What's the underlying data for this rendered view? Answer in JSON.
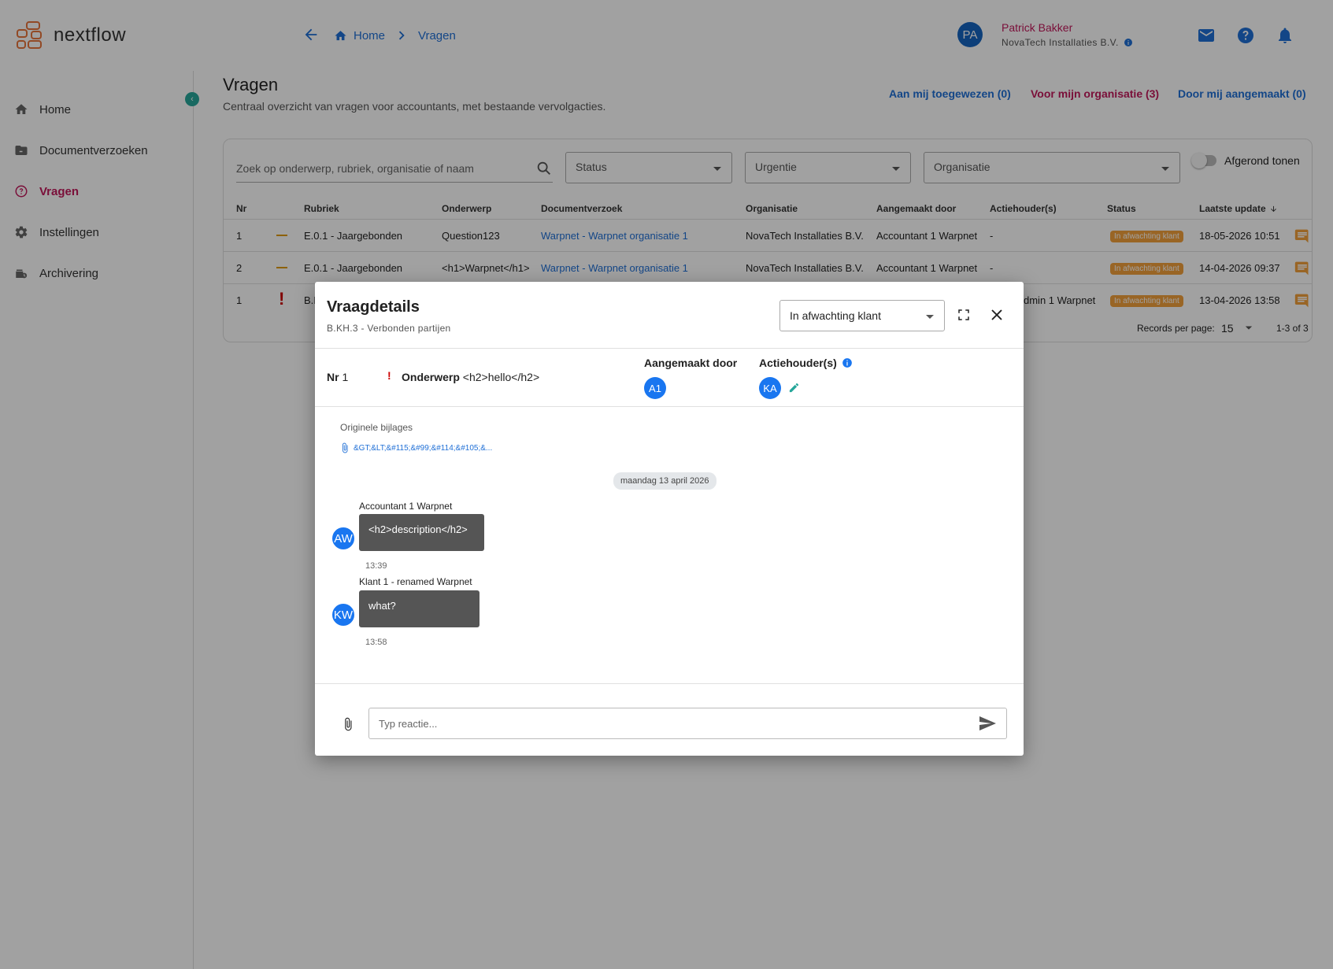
{
  "app": {
    "name": "nextflow"
  },
  "breadcrumb": {
    "home": "Home",
    "current": "Vragen"
  },
  "user": {
    "initials": "PA",
    "name": "Patrick Bakker",
    "organisation": "NovaTech Installaties B.V."
  },
  "sidebar": {
    "items": [
      {
        "label": "Home",
        "icon": "home-icon"
      },
      {
        "label": "Documentverzoeken",
        "icon": "folder-icon"
      },
      {
        "label": "Vragen",
        "icon": "question-circle-icon",
        "active": true
      },
      {
        "label": "Instellingen",
        "icon": "gear-icon"
      },
      {
        "label": "Archivering",
        "icon": "archive-icon"
      }
    ]
  },
  "page": {
    "title": "Vragen",
    "subtitle": "Centraal overzicht van vragen voor accountants, met bestaande vervolgacties."
  },
  "filters": {
    "assigned": "Aan mij toegewezen (0)",
    "organisation": "Voor mijn organisatie (3)",
    "created": "Door mij aangemaakt (0)",
    "search_placeholder": "Zoek op onderwerp, rubriek, organisatie of naam",
    "status": "Status",
    "urgency": "Urgentie",
    "org_select": "Organisatie",
    "show_done": "Afgerond tonen"
  },
  "table": {
    "headers": {
      "nr": "Nr",
      "rubriek": "Rubriek",
      "onderwerp": "Onderwerp",
      "documentverzoek": "Documentverzoek",
      "organisatie": "Organisatie",
      "aangemaakt": "Aangemaakt door",
      "actiehouders": "Actiehouder(s)",
      "status": "Status",
      "laatste": "Laatste update"
    },
    "rows": [
      {
        "nr": "1",
        "rubriek": "E.0.1 - Jaargebonden",
        "onderwerp": "Question123",
        "documentverzoek": "Warpnet - Warpnet organisatie 1",
        "organisatie": "NovaTech Installaties B.V.",
        "aangemaakt": "Accountant 1 Warpnet",
        "actiehouders": "-",
        "status": "In afwachting klant",
        "laatste": "18-05-2026 10:51"
      },
      {
        "nr": "2",
        "rubriek": "E.0.1 - Jaargebonden",
        "onderwerp": "<h1>Warpnet</h1>",
        "documentverzoek": "Warpnet - Warpnet organisatie 1",
        "organisatie": "NovaTech Installaties B.V.",
        "aangemaakt": "Accountant 1 Warpnet",
        "actiehouders": "-",
        "status": "In afwachting klant",
        "laatste": "14-04-2026 09:37"
      },
      {
        "nr": "1",
        "rubriek": "B.I",
        "actiehouders": "dmin 1 Warpnet",
        "status": "In afwachting klant",
        "laatste": "13-04-2026 13:58"
      }
    ],
    "pager": {
      "label": "Records per page:",
      "per_page": "15",
      "range": "1-3 of 3"
    }
  },
  "dialog": {
    "title": "Vraagdetails",
    "subtitle": "B.KH.3 - Verbonden partijen",
    "status": "In afwachting klant",
    "nr_label": "Nr",
    "nr_value": "1",
    "subject_label": "Onderwerp",
    "subject_value": "<h2>hello</h2>",
    "created_by_label": "Aangemaakt door",
    "created_by_initials": "A1",
    "action_holders_label": "Actiehouder(s)",
    "action_holders_initials": "KA",
    "attachments_label": "Originele bijlages",
    "attachment_name": "&GT;&LT;&#115;&#99;&#114;&#105;&...",
    "date_chip": "maandag 13 april 2026",
    "messages": [
      {
        "author": "Accountant 1 Warpnet",
        "initials": "AW",
        "text": "<h2>description</h2>",
        "time": "13:39"
      },
      {
        "author": "Klant 1 - renamed Warpnet",
        "initials": "KW",
        "text": "what?",
        "time": "13:58"
      }
    ],
    "reply_placeholder": "Typ reactie..."
  },
  "colors": {
    "primary": "#1f6fd6",
    "accent": "#c2185b",
    "warning": "#f3a13b",
    "bubble": "#555555",
    "avatar": "#1976f0"
  }
}
